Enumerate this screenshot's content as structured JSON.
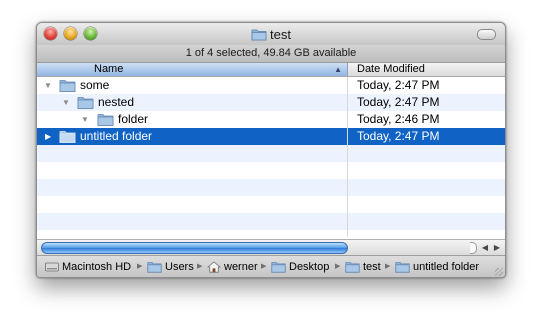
{
  "window": {
    "title": "test",
    "title_icon": "folder-icon"
  },
  "status_bar": {
    "text": "1 of 4 selected, 49.84 GB available"
  },
  "columns": {
    "name": "Name",
    "date": "Date Modified",
    "sort_indicator": "ascending"
  },
  "rows": [
    {
      "name": "some",
      "date": "Today, 2:47 PM",
      "disclosure": "expanded",
      "level": 0
    },
    {
      "name": "nested",
      "date": "Today, 2:47 PM",
      "disclosure": "expanded",
      "level": 1
    },
    {
      "name": "folder",
      "date": "Today, 2:46 PM",
      "disclosure": "expanded",
      "level": 2
    },
    {
      "name": "untitled folder",
      "date": "Today, 2:47 PM",
      "disclosure": "collapsed",
      "level": 0,
      "selected": true
    }
  ],
  "path": [
    {
      "label": "Macintosh HD",
      "icon": "hard-drive-icon"
    },
    {
      "label": "Users",
      "icon": "folder-icon"
    },
    {
      "label": "werner",
      "icon": "home-icon"
    },
    {
      "label": "Desktop",
      "icon": "folder-icon"
    },
    {
      "label": "test",
      "icon": "folder-icon"
    },
    {
      "label": "untitled folder",
      "icon": "folder-icon"
    }
  ],
  "colors": {
    "selection": "#1063c4",
    "alt_row": "#edf3fe",
    "header_sorted": "#92b5e3"
  }
}
